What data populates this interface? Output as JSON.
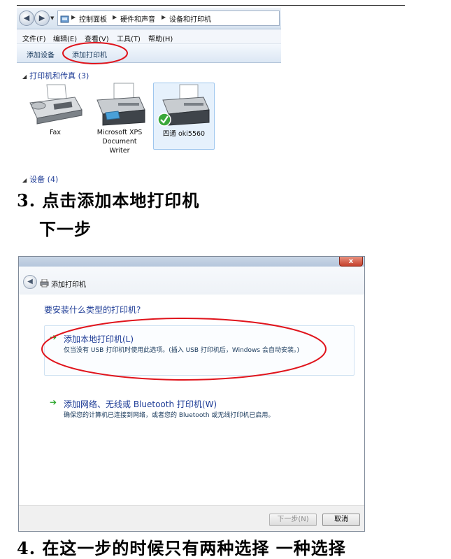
{
  "control_panel": {
    "breadcrumb": [
      "控制面板",
      "硬件和声音",
      "设备和打印机"
    ],
    "menu": [
      "文件(F)",
      "编辑(E)",
      "查看(V)",
      "工具(T)",
      "帮助(H)"
    ],
    "commands": [
      "添加设备",
      "添加打印机"
    ],
    "group_printers": "打印机和传真 (3)",
    "group_devices": "设备 (4)",
    "devices": [
      {
        "label": "Fax"
      },
      {
        "label": "Microsoft XPS\nDocument\nWriter"
      },
      {
        "label": "四通 oki5560"
      }
    ]
  },
  "step3": {
    "heading": "3. 点击添加本地打印机",
    "subheading": "下一步"
  },
  "dialog": {
    "title": "添加打印机",
    "close_label": "x",
    "question": "要安装什么类型的打印机?",
    "option_local": {
      "title": "添加本地打印机(L)",
      "description": "仅当没有 USB 打印机时使用此选项。(插入 USB 打印机后，Windows 会自动安装。)"
    },
    "option_network": {
      "title": "添加网络、无线或 Bluetooth 打印机(W)",
      "description": "确保您的计算机已连接到网络，或者您的 Bluetooth 或无线打印机已启用。"
    },
    "next_label": "下一步(N)",
    "cancel_label": "取消"
  },
  "step4": {
    "heading": "4. 在这一步的时候只有两种选择 一种选择"
  },
  "colors": {
    "highlight_ellipse": "#e0141c",
    "link_blue": "#1e3c96",
    "arrow_green": "#2aa52a"
  }
}
